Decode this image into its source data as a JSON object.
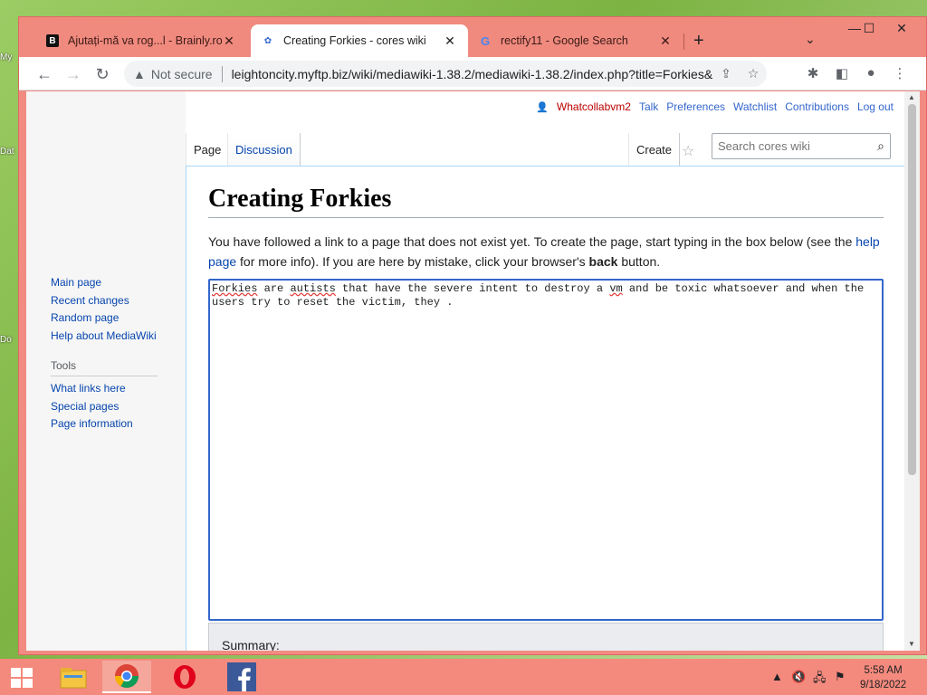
{
  "desktop": {
    "icons": [
      "My",
      "Dat",
      "Do"
    ]
  },
  "tabs": [
    {
      "title": "Ajutați-mă va rog...l - Brainly.ro",
      "favicon": "brainly-icon"
    },
    {
      "title": "Creating Forkies - cores wiki",
      "favicon": "mediawiki-icon"
    },
    {
      "title": "rectify11 - Google Search",
      "favicon": "google-icon"
    }
  ],
  "toolbar": {
    "security_label": "Not secure",
    "url": "leightoncity.myftp.biz/wiki/mediawiki-1.38.2/mediawiki-1.38.2/index.php?title=Forkies&..."
  },
  "personal": {
    "username": "Whatcollabvm2",
    "talk": "Talk",
    "preferences": "Preferences",
    "watchlist": "Watchlist",
    "contributions": "Contributions",
    "logout": "Log out"
  },
  "namespaces": {
    "page": "Page",
    "discussion": "Discussion",
    "create": "Create"
  },
  "search": {
    "placeholder": "Search cores wiki"
  },
  "navigation": {
    "items": [
      "Main page",
      "Recent changes",
      "Random page",
      "Help about MediaWiki"
    ]
  },
  "tools": {
    "heading": "Tools",
    "items": [
      "What links here",
      "Special pages",
      "Page information"
    ]
  },
  "content": {
    "title": "Creating Forkies",
    "intro_part1": "You have followed a link to a page that does not exist yet. To create the page, start typing in the box below (see the ",
    "help_link": "help page",
    "intro_part2": " for more info). If you are here by mistake, click your browser's ",
    "back_word": "back",
    "intro_part3": " button.",
    "editor_text_1": "Forkies",
    "editor_text_2": " are ",
    "editor_text_3": "autists",
    "editor_text_4": " that have the severe intent to destroy a ",
    "editor_text_5": "vm",
    "editor_text_6": " and be toxic whatsoever and when the users try to reset the victim, they .",
    "summary_label": "Summary:"
  },
  "taskbar": {
    "time": "5:58 AM",
    "date": "9/18/2022"
  }
}
